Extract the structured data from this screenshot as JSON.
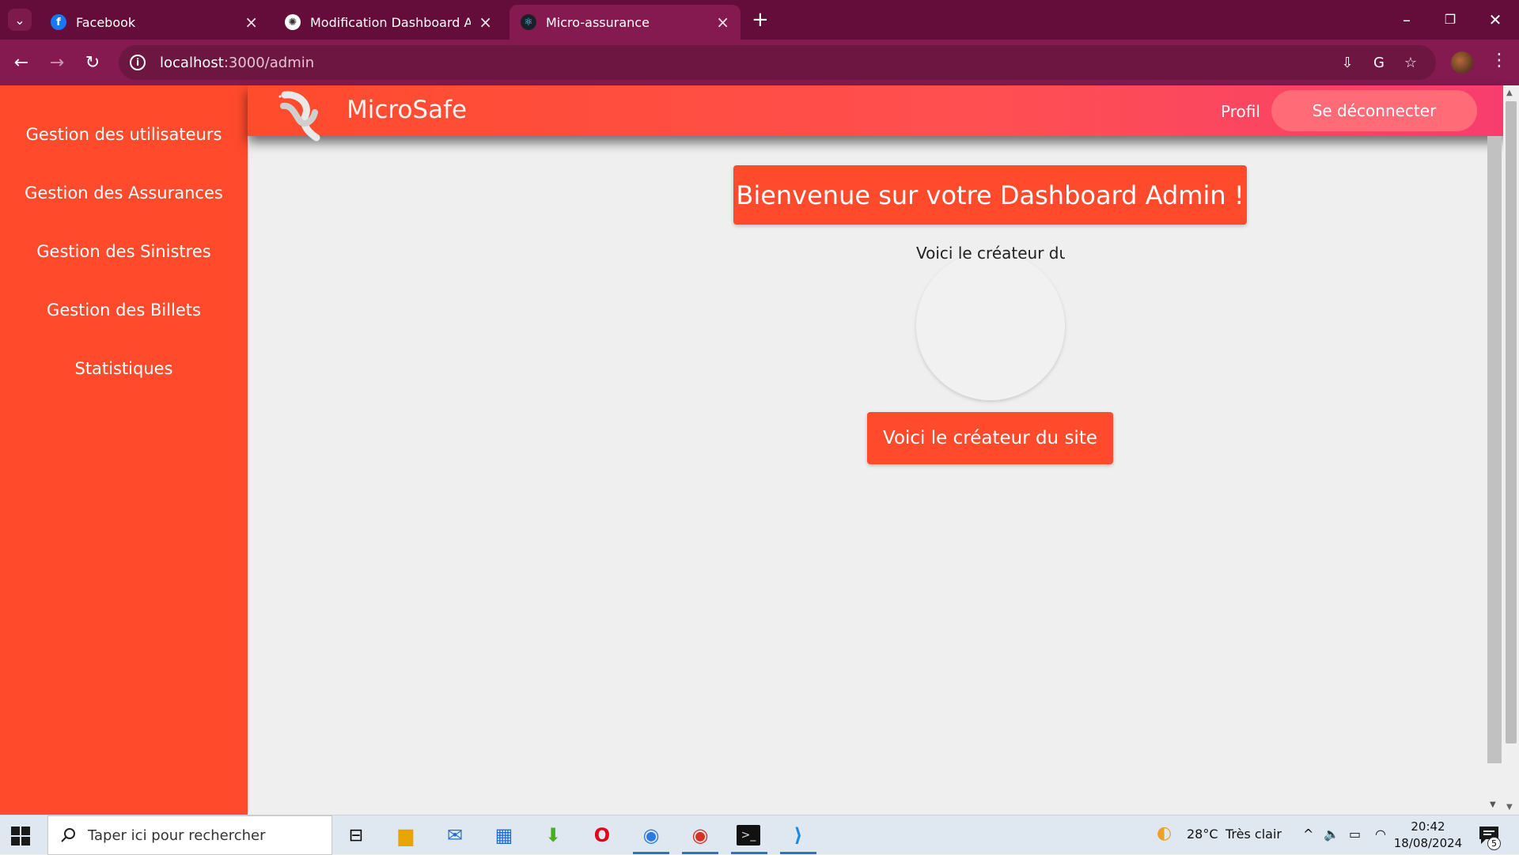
{
  "browser": {
    "tabs": [
      {
        "title": "Facebook",
        "favicon": "facebook-icon",
        "active": false
      },
      {
        "title": "Modification Dashboard Admin",
        "favicon": "chatgpt-icon",
        "active": false
      },
      {
        "title": "Micro-assurance",
        "favicon": "react-icon",
        "active": true
      }
    ],
    "url_host": "localhost",
    "url_path": ":3000/admin"
  },
  "sidebar": {
    "items": [
      {
        "label": "Gestion des utilisateurs"
      },
      {
        "label": "Gestion des Assurances"
      },
      {
        "label": "Gestion des Sinistres"
      },
      {
        "label": "Gestion des Billets"
      },
      {
        "label": "Statistiques"
      }
    ]
  },
  "header": {
    "brand": "MicroSafe",
    "profile_link": "Profil",
    "logout_button": "Se déconnecter"
  },
  "main": {
    "welcome_title": "Bienvenue sur votre Dashboard Admin !",
    "avatar_alt_text": "Voici le créateur du site",
    "creator_button": "Voici le créateur du site"
  },
  "taskbar": {
    "search_placeholder": "Taper ici pour rechercher",
    "weather_temp": "28°C",
    "weather_desc": "Très clair",
    "time": "20:42",
    "date": "18/08/2024",
    "notification_count": "5"
  },
  "colors": {
    "primary": "#ff4a2c",
    "browser_frame": "#650d3a",
    "logout_pill": "#ff6b77"
  }
}
